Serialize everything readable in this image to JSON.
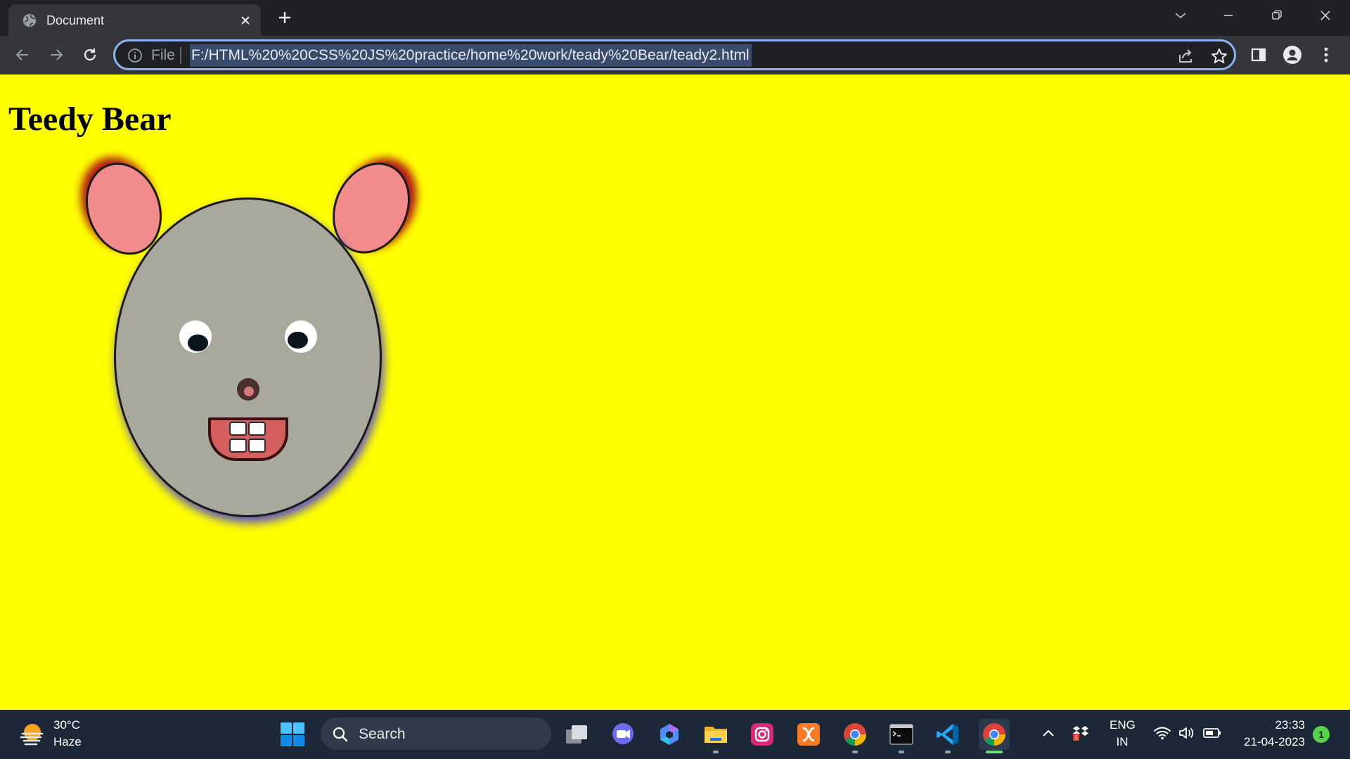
{
  "browser": {
    "tab": {
      "title": "Document"
    },
    "address": {
      "scheme_label": "File",
      "url": "F:/HTML%20%20CSS%20JS%20practice/home%20work/teady%20Bear/teady2.html"
    }
  },
  "page": {
    "heading": "Teedy Bear",
    "background": "#ffff00",
    "bear_colors": {
      "head": "#a8a89c",
      "ear": "#f28c8c",
      "ear_glow": "#b01818",
      "mouth": "#d45f5f",
      "head_shadow": "#5b50c8"
    }
  },
  "taskbar": {
    "weather": {
      "temp": "30°C",
      "desc": "Haze"
    },
    "search_label": "Search",
    "apps": [
      "task-view",
      "meet",
      "copilot",
      "file-explorer",
      "instagram",
      "xampp",
      "chrome",
      "terminal",
      "vscode",
      "chrome-active"
    ],
    "language": {
      "line1": "ENG",
      "line2": "IN"
    },
    "clock": {
      "time": "23:33",
      "date": "21-04-2023"
    },
    "notifications": "1"
  }
}
